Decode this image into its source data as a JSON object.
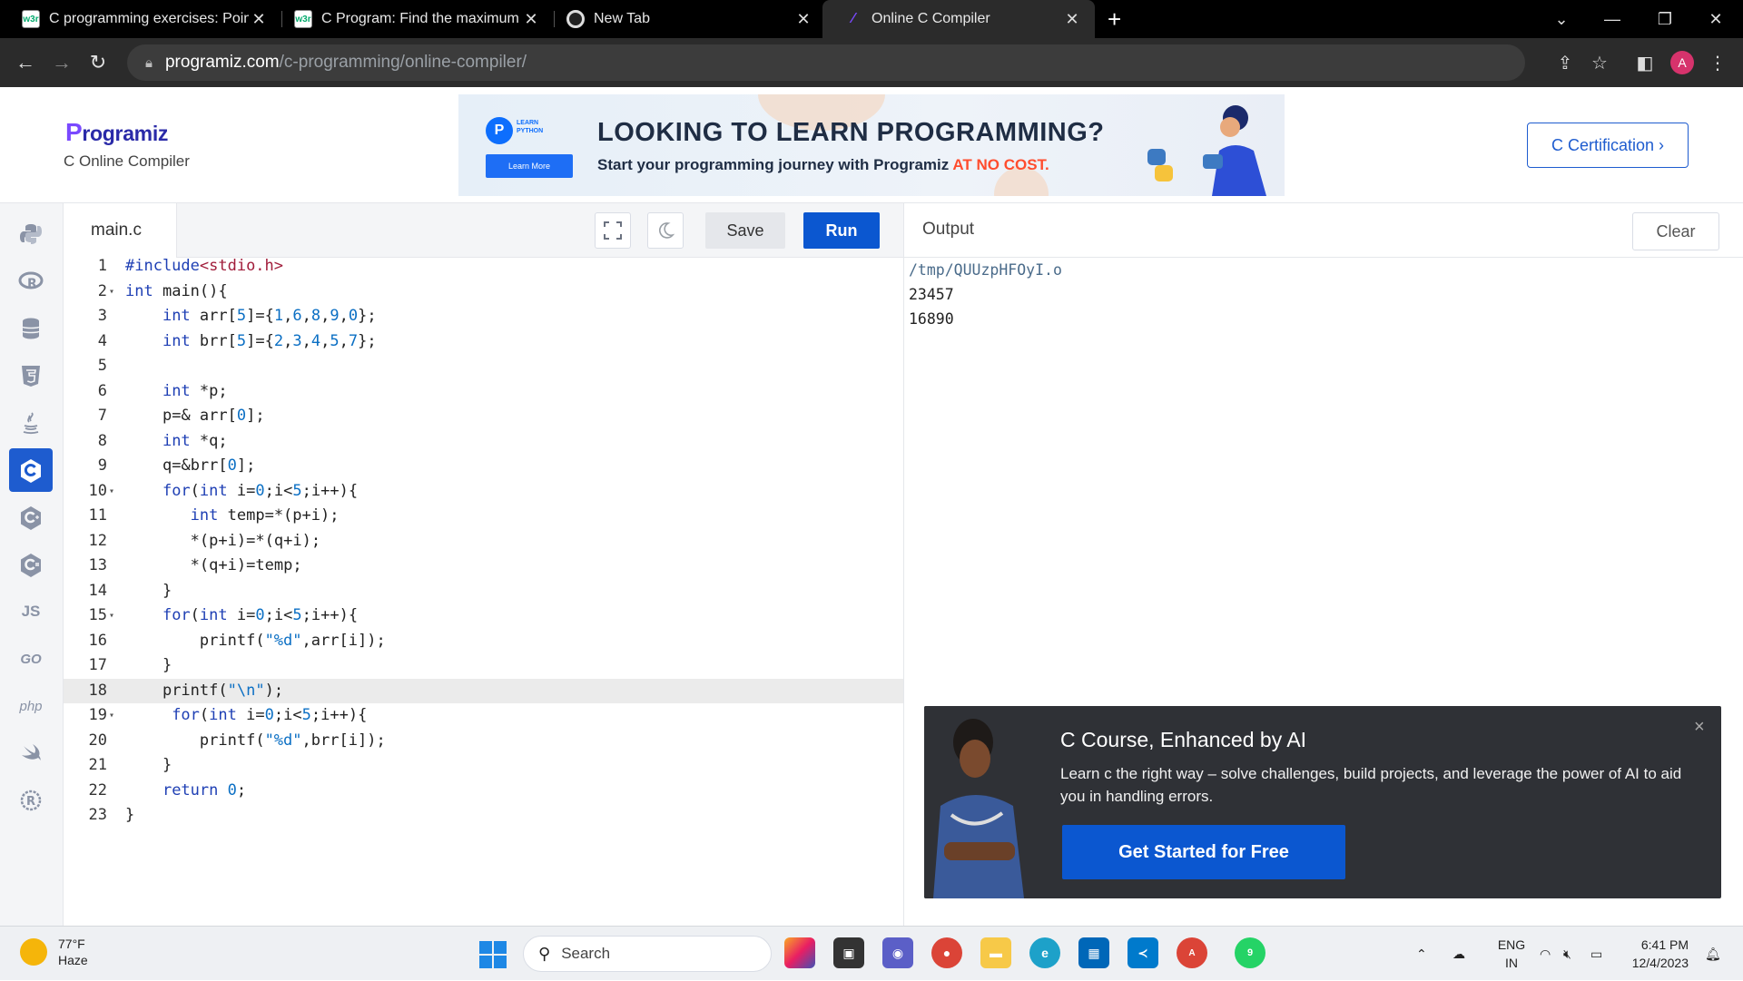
{
  "browser": {
    "tabs": [
      {
        "title": "C programming exercises: Pointe",
        "favicon": "w3r"
      },
      {
        "title": "C Program: Find the maximum n",
        "favicon": "w3r"
      },
      {
        "title": "New Tab",
        "favicon": "chrome-icon"
      },
      {
        "title": "Online C Compiler",
        "favicon": "programiz-icon"
      }
    ],
    "url_host": "programiz.com",
    "url_path": "/c-programming/online-compiler/",
    "profile_initial": "A"
  },
  "site": {
    "logo": "rogramiz",
    "logo_p": "P",
    "subtitle": "C Online Compiler",
    "banner": {
      "logo_letter": "P",
      "brand_small": "LEARN PYTHON",
      "learn_more": "Learn More",
      "headline": "LOOKING TO LEARN PROGRAMMING?",
      "subline": "Start your programming journey with Programiz ",
      "subline_highlight": "AT NO COST."
    },
    "cert_button": "C Certification ›"
  },
  "rail": {
    "items": [
      "python-icon",
      "r-icon",
      "sql-icon",
      "html-icon",
      "java-icon",
      "c-icon",
      "cpp-icon",
      "csharp-icon",
      "JS",
      "GO",
      "php",
      "swift-icon",
      "rust-icon"
    ],
    "active_index": 5
  },
  "editor": {
    "filename": "main.c",
    "save_label": "Save",
    "run_label": "Run",
    "highlighted_line": 18,
    "lines": [
      {
        "n": "1",
        "fold": "",
        "code": "#include<stdio.h>"
      },
      {
        "n": "2",
        "fold": "▾",
        "code": "int main(){"
      },
      {
        "n": "3",
        "fold": "",
        "code": "    int arr[5]={1,6,8,9,0};"
      },
      {
        "n": "4",
        "fold": "",
        "code": "    int brr[5]={2,3,4,5,7};"
      },
      {
        "n": "5",
        "fold": "",
        "code": ""
      },
      {
        "n": "6",
        "fold": "",
        "code": "    int *p;"
      },
      {
        "n": "7",
        "fold": "",
        "code": "    p=& arr[0];"
      },
      {
        "n": "8",
        "fold": "",
        "code": "    int *q;"
      },
      {
        "n": "9",
        "fold": "",
        "code": "    q=&brr[0];"
      },
      {
        "n": "10",
        "fold": "▾",
        "code": "    for(int i=0;i<5;i++){"
      },
      {
        "n": "11",
        "fold": "",
        "code": "       int temp=*(p+i);"
      },
      {
        "n": "12",
        "fold": "",
        "code": "       *(p+i)=*(q+i);"
      },
      {
        "n": "13",
        "fold": "",
        "code": "       *(q+i)=temp;"
      },
      {
        "n": "14",
        "fold": "",
        "code": "    }"
      },
      {
        "n": "15",
        "fold": "▾",
        "code": "    for(int i=0;i<5;i++){"
      },
      {
        "n": "16",
        "fold": "",
        "code": "        printf(\"%d\",arr[i]);"
      },
      {
        "n": "17",
        "fold": "",
        "code": "    }"
      },
      {
        "n": "18",
        "fold": "",
        "code": "    printf(\"\\n\");"
      },
      {
        "n": "19",
        "fold": "▾",
        "code": "     for(int i=0;i<5;i++){"
      },
      {
        "n": "20",
        "fold": "",
        "code": "        printf(\"%d\",brr[i]);"
      },
      {
        "n": "21",
        "fold": "",
        "code": "    }"
      },
      {
        "n": "22",
        "fold": "",
        "code": "    return 0;"
      },
      {
        "n": "23",
        "fold": "",
        "code": "}"
      }
    ]
  },
  "output": {
    "label": "Output",
    "clear_label": "Clear",
    "lines": [
      "/tmp/QUUzpHFOyI.o",
      "23457",
      "16890"
    ]
  },
  "promo": {
    "title": "C Course, Enhanced by AI",
    "body": "Learn c the right way – solve challenges, build projects, and leverage the power of AI to aid you in handling errors.",
    "cta": "Get Started for Free",
    "close": "×"
  },
  "taskbar": {
    "temperature": "77°F",
    "condition": "Haze",
    "search_placeholder": "Search",
    "lang1": "ENG",
    "lang2": "IN",
    "time": "6:41 PM",
    "date": "12/4/2023",
    "whatsapp_badge": "9",
    "chrome_badge": "A"
  },
  "colors": {
    "accent": "#0b57d0",
    "chrome_bg": "#000000",
    "promo_bg": "#2f3136"
  }
}
